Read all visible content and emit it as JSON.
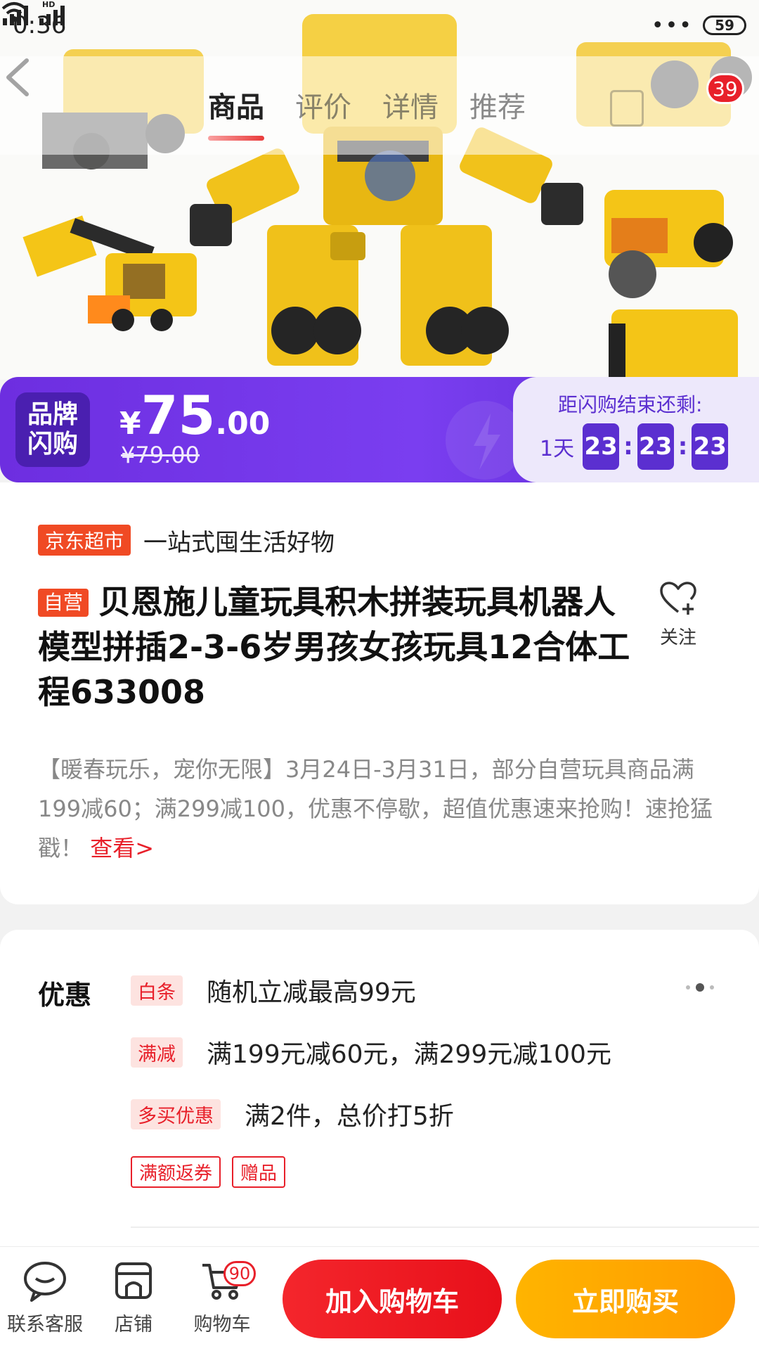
{
  "status_bar": {
    "time": "0:36",
    "signal_dots": "•••",
    "network_tag": "HD",
    "battery": "59"
  },
  "nav": {
    "tabs": [
      {
        "label": "商品",
        "active": true
      },
      {
        "label": "评价",
        "active": false
      },
      {
        "label": "详情",
        "active": false
      },
      {
        "label": "推荐",
        "active": false
      }
    ],
    "cart_badge": "39"
  },
  "flash_sale": {
    "logo_line1": "品牌",
    "logo_line2": "闪购",
    "currency": "¥",
    "price_int": "75",
    "price_dec": ".00",
    "price_old": "¥79.00",
    "countdown_label": "距闪购结束还剩:",
    "days": "1天",
    "hours": "23",
    "minutes": "23",
    "seconds": "23",
    "sep": ":"
  },
  "product": {
    "store_tag": "京东超市",
    "slogan": "一站式囤生活好物",
    "self_tag": "自营",
    "title": "贝恩施儿童玩具积木拼装玩具机器人模型拼插2-3-6岁男孩女孩玩具12合体工程633008",
    "follow_label": "关注",
    "promo_text": "【暖春玩乐，宠你无限】3月24日-3月31日，部分自营玩具商品满199减60；满299减100，优惠不停歇，超值优惠速来抢购！速抢猛戳！",
    "promo_link": "查看>"
  },
  "discounts": {
    "title": "优惠",
    "rows": [
      {
        "tag": "白条",
        "text": "随机立减最高99元"
      },
      {
        "tag": "满减",
        "text": "满199元减60元，满299元减100元"
      },
      {
        "tag": "多买优惠",
        "text": "满2件，总价打5折"
      }
    ],
    "outline_tags": [
      "满额返券",
      "赠品"
    ]
  },
  "bottom_bar": {
    "service_label": "联系客服",
    "store_label": "店铺",
    "cart_label": "购物车",
    "cart_badge": "90",
    "add_to_cart": "加入购物车",
    "buy_now": "立即购买"
  },
  "colors": {
    "accent_red": "#e8202a",
    "flash_purple": "#6d2ee0",
    "buy_orange": "#ffa800"
  }
}
